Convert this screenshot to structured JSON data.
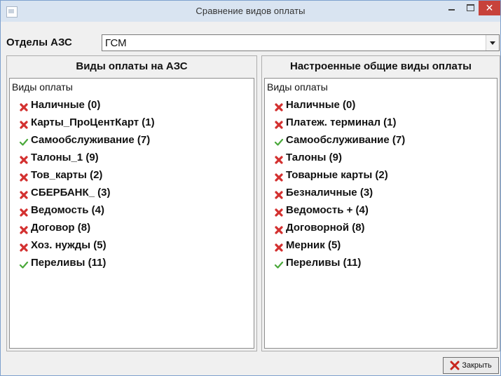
{
  "window": {
    "title": "Сравнение видов оплаты"
  },
  "department": {
    "label": "Отделы АЗС",
    "value": "ГСМ"
  },
  "left_panel": {
    "header": "Виды оплаты на АЗС",
    "root": "Виды оплаты",
    "items": [
      {
        "label": "Наличные (0)",
        "status": "cross"
      },
      {
        "label": "Карты_ПроЦентКарт (1)",
        "status": "cross"
      },
      {
        "label": "Самообслуживание (7)",
        "status": "check"
      },
      {
        "label": "Талоны_1 (9)",
        "status": "cross"
      },
      {
        "label": "Тов_карты (2)",
        "status": "cross"
      },
      {
        "label": "СБЕРБАНК_ (3)",
        "status": "cross"
      },
      {
        "label": "Ведомость (4)",
        "status": "cross"
      },
      {
        "label": "Договор (8)",
        "status": "cross"
      },
      {
        "label": "Хоз. нужды (5)",
        "status": "cross"
      },
      {
        "label": "Переливы (11)",
        "status": "check"
      }
    ]
  },
  "right_panel": {
    "header": "Настроенные общие виды оплаты",
    "root": "Виды оплаты",
    "items": [
      {
        "label": "Наличные (0)",
        "status": "cross"
      },
      {
        "label": "Платеж. терминал (1)",
        "status": "cross"
      },
      {
        "label": "Самообслуживание (7)",
        "status": "check"
      },
      {
        "label": "Талоны (9)",
        "status": "cross"
      },
      {
        "label": "Товарные карты (2)",
        "status": "cross"
      },
      {
        "label": "Безналичные (3)",
        "status": "cross"
      },
      {
        "label": "Ведомость + (4)",
        "status": "cross"
      },
      {
        "label": "Договорной (8)",
        "status": "cross"
      },
      {
        "label": "Мерник (5)",
        "status": "cross"
      },
      {
        "label": "Переливы (11)",
        "status": "check"
      }
    ]
  },
  "footer": {
    "close_label": "Закрыть"
  },
  "icons": {
    "cross": "cross-icon",
    "check": "check-icon"
  },
  "colors": {
    "cross": "#d3302f",
    "check": "#4aa83a",
    "titlebar": "#d9e4f1",
    "close": "#c7423b"
  }
}
